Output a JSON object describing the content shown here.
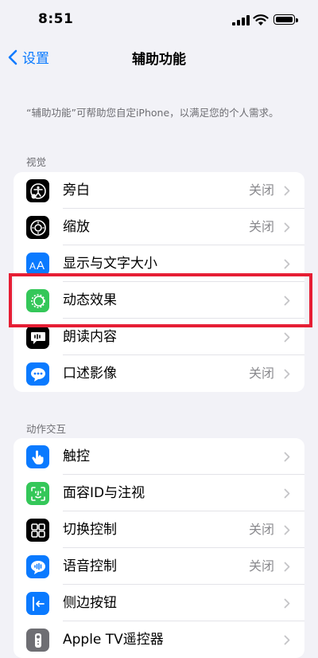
{
  "status": {
    "time": "8:51"
  },
  "nav": {
    "back_label": "设置",
    "title": "辅助功能"
  },
  "description": "“辅助功能”可帮助您自定iPhone，以满足您的个人需求。",
  "vision": {
    "header": "视觉",
    "items": [
      {
        "label": "旁白",
        "value": "关闭",
        "icon": "voiceover-icon",
        "color": "#000000"
      },
      {
        "label": "缩放",
        "value": "关闭",
        "icon": "zoom-icon",
        "color": "#000000"
      },
      {
        "label": "显示与文字大小",
        "value": "",
        "icon": "text-size-icon",
        "color": "#0a7aff"
      },
      {
        "label": "动态效果",
        "value": "",
        "icon": "motion-icon",
        "color": "#34c759"
      },
      {
        "label": "朗读内容",
        "value": "",
        "icon": "spoken-content-icon",
        "color": "#000000"
      },
      {
        "label": "口述影像",
        "value": "关闭",
        "icon": "audio-description-icon",
        "color": "#0a7aff"
      }
    ]
  },
  "interaction": {
    "header": "动作交互",
    "items": [
      {
        "label": "触控",
        "value": "",
        "icon": "touch-icon",
        "color": "#0a7aff"
      },
      {
        "label": "面容ID与注视",
        "value": "",
        "icon": "face-id-icon",
        "color": "#34c759"
      },
      {
        "label": "切换控制",
        "value": "关闭",
        "icon": "switch-control-icon",
        "color": "#000000"
      },
      {
        "label": "语音控制",
        "value": "关闭",
        "icon": "voice-control-icon",
        "color": "#0a7aff"
      },
      {
        "label": "侧边按钮",
        "value": "",
        "icon": "side-button-icon",
        "color": "#0a7aff"
      },
      {
        "label": "Apple TV遥控器",
        "value": "",
        "icon": "apple-tv-remote-icon",
        "color": "#6e6e73"
      }
    ]
  },
  "highlight_color": "#e61e34"
}
